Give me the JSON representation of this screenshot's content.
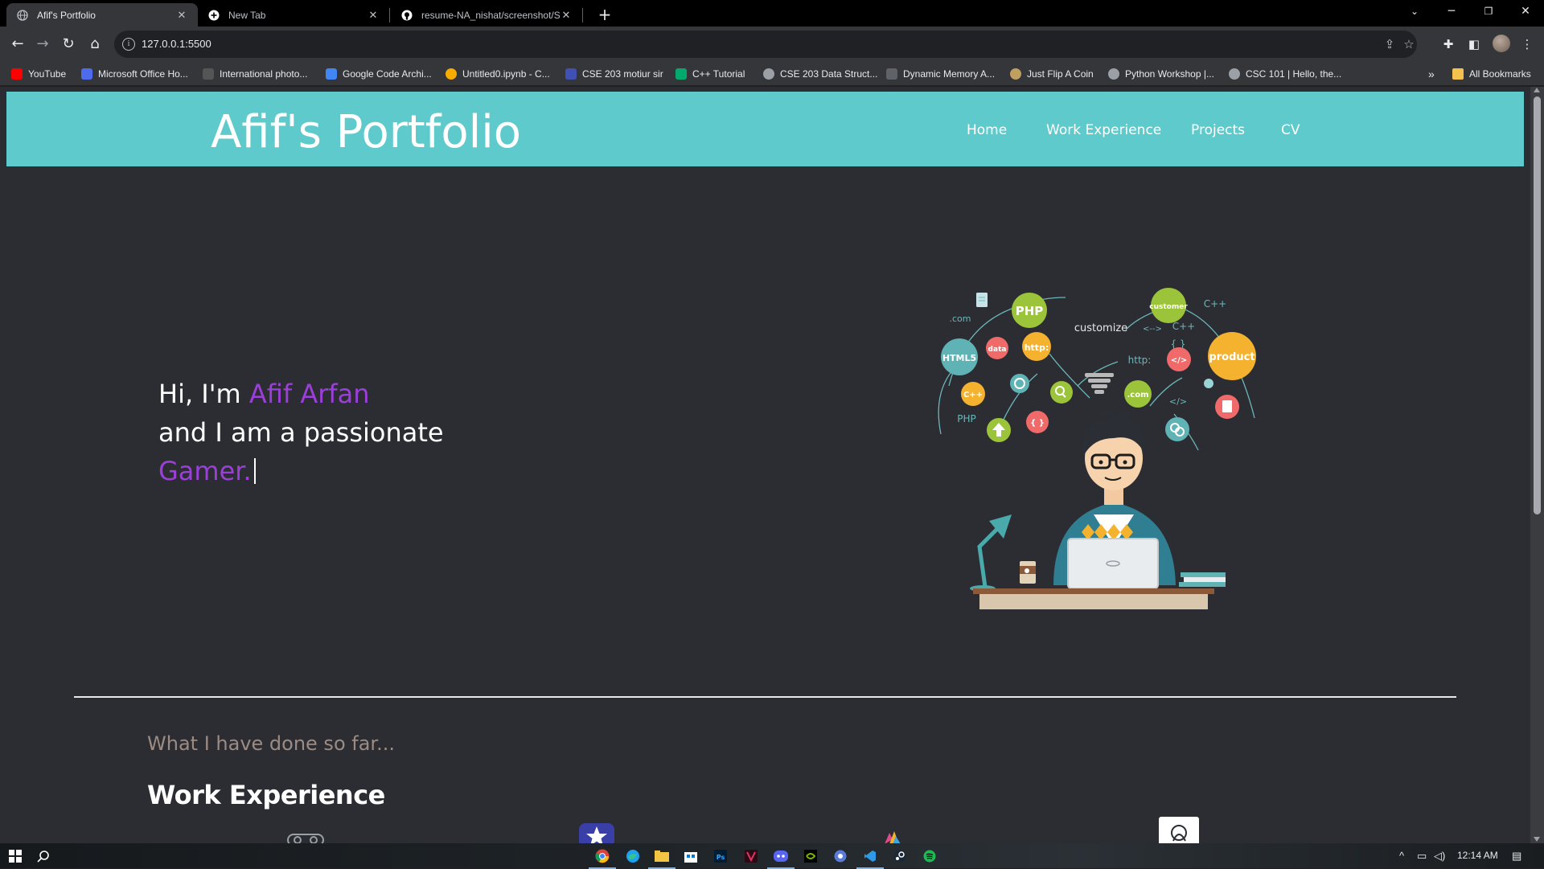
{
  "browser": {
    "tabs": [
      {
        "title": "Afif's Portfolio",
        "icon": "globe-icon",
        "active": true
      },
      {
        "title": "New Tab",
        "icon": "chrome-newtab-icon",
        "active": false
      },
      {
        "title": "resume-NA_nishat/screenshot/S",
        "icon": "github-icon",
        "active": false
      }
    ],
    "url": "127.0.0.1:5500",
    "bookmarks": [
      {
        "label": "YouTube",
        "color": "#ff0000"
      },
      {
        "label": "Microsoft Office Ho...",
        "color": "#4f6bed"
      },
      {
        "label": "International photo...",
        "color": "#555555"
      },
      {
        "label": "Google Code Archi...",
        "color": "#4285f4"
      },
      {
        "label": "Untitled0.ipynb - C...",
        "color": "#f9ab00"
      },
      {
        "label": "CSE 203 motiur sir",
        "color": "#3f51b5"
      },
      {
        "label": "C++ Tutorial",
        "color": "#04aa6d"
      },
      {
        "label": "CSE 203 Data Struct...",
        "color": "#9aa0a6"
      },
      {
        "label": "Dynamic Memory A...",
        "color": "#5f6368"
      },
      {
        "label": "Just Flip A Coin",
        "color": "#c0a060"
      },
      {
        "label": "Python Workshop |...",
        "color": "#9aa0a6"
      },
      {
        "label": "CSC 101 | Hello, the...",
        "color": "#9aa0a6"
      }
    ],
    "all_bookmarks_label": "All Bookmarks",
    "more_label": "»"
  },
  "site": {
    "title": "Afif's Portfolio",
    "nav": [
      "Home",
      "Work Experience",
      "Projects",
      "CV"
    ],
    "hero": {
      "line1_prefix": "Hi, I'm ",
      "name": "Afif Arfan",
      "line2": "and I am a passionate",
      "typed_word": "Gamer."
    },
    "subheading": "What I have done so far...",
    "section_title": "Work Experience",
    "illustration_words": {
      "php": "PHP",
      "customer": "customer",
      "cpp": "C++",
      "com": ".com",
      "customize": "customize",
      "arrows": "<-->",
      "braces": "{ }",
      "html5": "HTML5",
      "data": "data",
      "http": "http:",
      "product": "product",
      "tag": "</>"
    },
    "colors": {
      "header_bg": "#5fcacb",
      "accent_purple": "#9b3fd9",
      "page_bg": "#2c2d33"
    }
  },
  "taskbar": {
    "time": "12:14 AM"
  }
}
